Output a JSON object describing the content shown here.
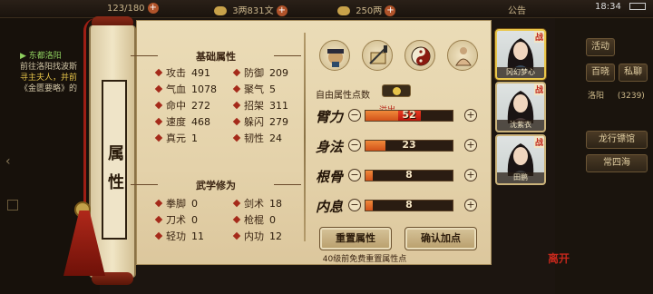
{
  "topbar": {
    "energy": "123/180",
    "money": "3两831文",
    "silver": "250两",
    "notice": "公告",
    "time": "18:34"
  },
  "quest": {
    "title": "▶ 东都洛阳",
    "lines": [
      "前往洛阳找波斯",
      "寻主夫人，并前",
      "《金匮要略》的"
    ]
  },
  "right_panel": {
    "buttons": [
      "活动",
      "百晓",
      "私聊"
    ],
    "location": "洛阳",
    "coord": "(3239)",
    "menu_items": [
      "龙行镖馆",
      "常四海"
    ]
  },
  "scroll": {
    "label": "属性"
  },
  "base_attrs": {
    "title": "基础属性",
    "items": [
      {
        "k": "攻击",
        "v": "491"
      },
      {
        "k": "防御",
        "v": "209"
      },
      {
        "k": "气血",
        "v": "1078"
      },
      {
        "k": "聚气",
        "v": "5"
      },
      {
        "k": "命中",
        "v": "272"
      },
      {
        "k": "招架",
        "v": "311"
      },
      {
        "k": "速度",
        "v": "468"
      },
      {
        "k": "躲闪",
        "v": "279"
      },
      {
        "k": "真元",
        "v": "1"
      },
      {
        "k": "韧性",
        "v": "24"
      }
    ]
  },
  "martial": {
    "title": "武学修为",
    "items": [
      {
        "k": "拳脚",
        "v": "0"
      },
      {
        "k": "剑术",
        "v": "18"
      },
      {
        "k": "刀术",
        "v": "0"
      },
      {
        "k": "枪棍",
        "v": "0"
      },
      {
        "k": "轻功",
        "v": "11"
      },
      {
        "k": "内功",
        "v": "12"
      }
    ]
  },
  "points": {
    "free_label": "自由属性点数",
    "overflow_label": "溢出",
    "stats": [
      {
        "name": "臂力",
        "value": "52",
        "fill": 0.38,
        "over": 0.26
      },
      {
        "name": "身法",
        "value": "23",
        "fill": 0.23,
        "over": 0
      },
      {
        "name": "根骨",
        "value": "8",
        "fill": 0.08,
        "over": 0
      },
      {
        "name": "内息",
        "value": "8",
        "fill": 0.08,
        "over": 0
      }
    ],
    "reset_label": "重置属性",
    "confirm_label": "确认加点",
    "hint": "40级前免费重置属性点"
  },
  "characters": [
    {
      "name": "冈幻梦心",
      "battle": "战"
    },
    {
      "name": "沈紫衣",
      "battle": "战"
    },
    {
      "name": "田鹏",
      "battle": "战"
    }
  ],
  "seal_text": "离开",
  "colors": {
    "accent": "#b51d10",
    "paper": "#e6d6ae",
    "bar_fill": "#e06a26"
  }
}
